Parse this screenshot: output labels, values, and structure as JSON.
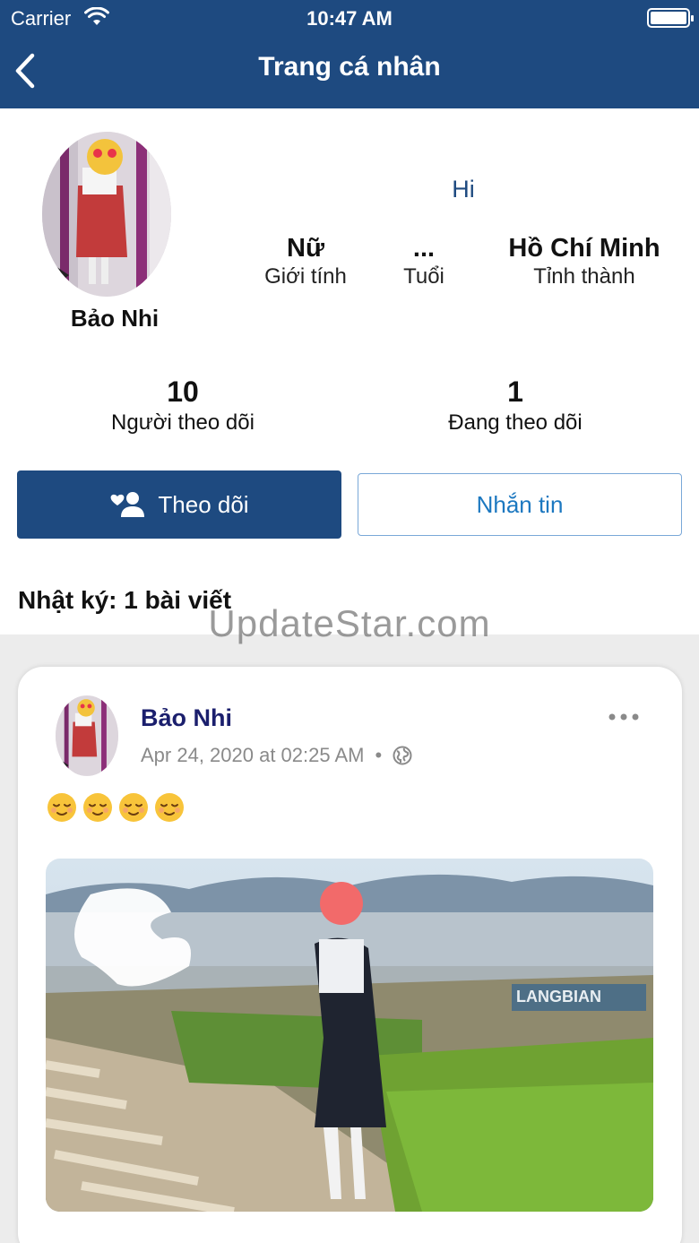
{
  "status_bar": {
    "carrier": "Carrier",
    "time": "10:47 AM"
  },
  "nav": {
    "title": "Trang cá nhân",
    "back_icon": "chevron-left-icon"
  },
  "profile": {
    "name": "Bảo Nhi",
    "bio": "Hi",
    "gender_value": "Nữ",
    "gender_label": "Giới tính",
    "age_value": "...",
    "age_label": "Tuổi",
    "city_value": "Hồ Chí Minh",
    "city_label": "Tỉnh thành"
  },
  "stats": {
    "followers_value": "10",
    "followers_label": "Người theo dõi",
    "following_value": "1",
    "following_label": "Đang theo dõi"
  },
  "actions": {
    "follow_label": "Theo dõi",
    "message_label": "Nhắn tin"
  },
  "diary": {
    "title": "Nhật ký: 1 bài viết"
  },
  "watermark": "UpdateStar.com",
  "post": {
    "author": "Bảo Nhi",
    "timestamp": "Apr 24, 2020 at 02:25 AM",
    "separator": "•",
    "privacy_icon": "globe-icon",
    "content_emoji_count": 4,
    "more_icon": "more-horizontal-icon"
  },
  "colors": {
    "primary": "#1e4a80",
    "link": "#1c78c0",
    "author": "#1b1f6d"
  }
}
